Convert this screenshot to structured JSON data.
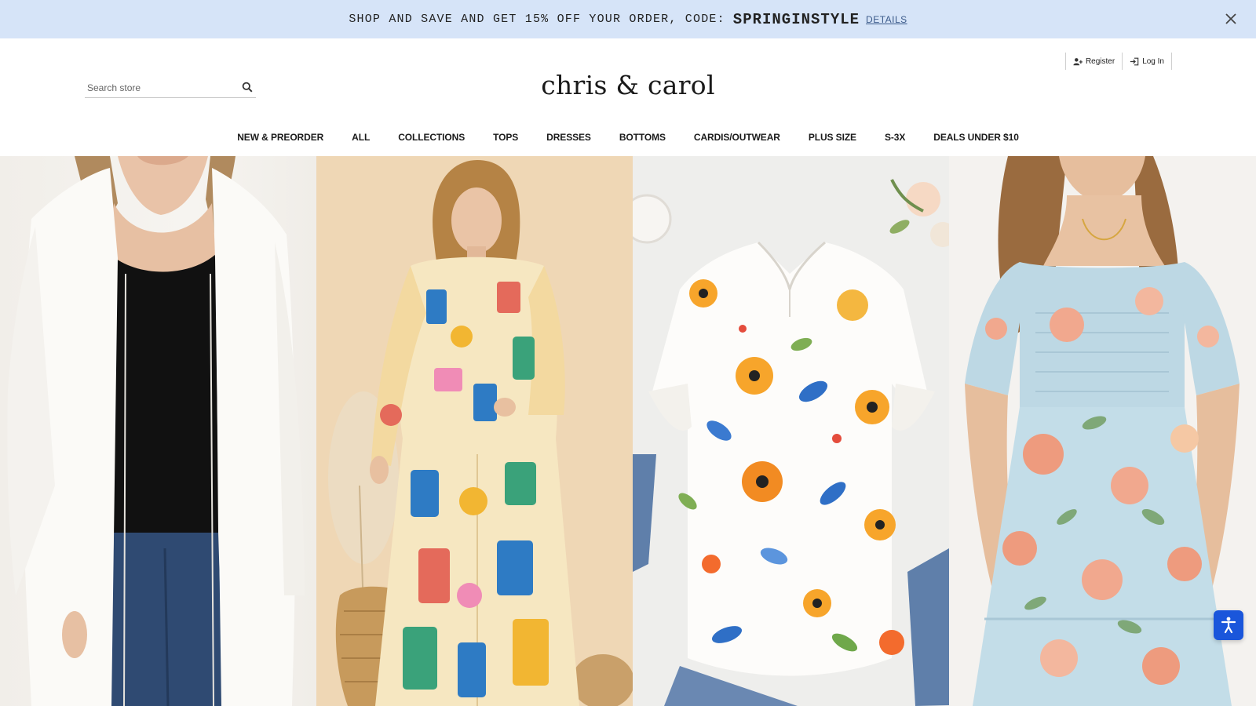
{
  "promo": {
    "text": "SHOP AND SAVE AND GET 15% OFF YOUR ORDER, CODE:",
    "code": "SPRINGINSTYLE",
    "details": "DETAILS"
  },
  "account": {
    "register": "Register",
    "login": "Log In"
  },
  "search": {
    "placeholder": "Search store"
  },
  "logo": "chris & carol",
  "nav": [
    "NEW & PREORDER",
    "ALL",
    "COLLECTIONS",
    "TOPS",
    "DRESSES",
    "BOTTOMS",
    "CARDIS/OUTWEAR",
    "PLUS SIZE",
    "S-3X",
    "DEALS UNDER $10"
  ],
  "hero_panels": [
    "white-cardigan-photo",
    "printed-two-piece-set-photo",
    "floral-blouse-flatlay-photo",
    "floral-midi-dress-photo"
  ],
  "colors": {
    "promo_bg": "#d6e4f8",
    "accessibility_button": "#1a56db"
  }
}
